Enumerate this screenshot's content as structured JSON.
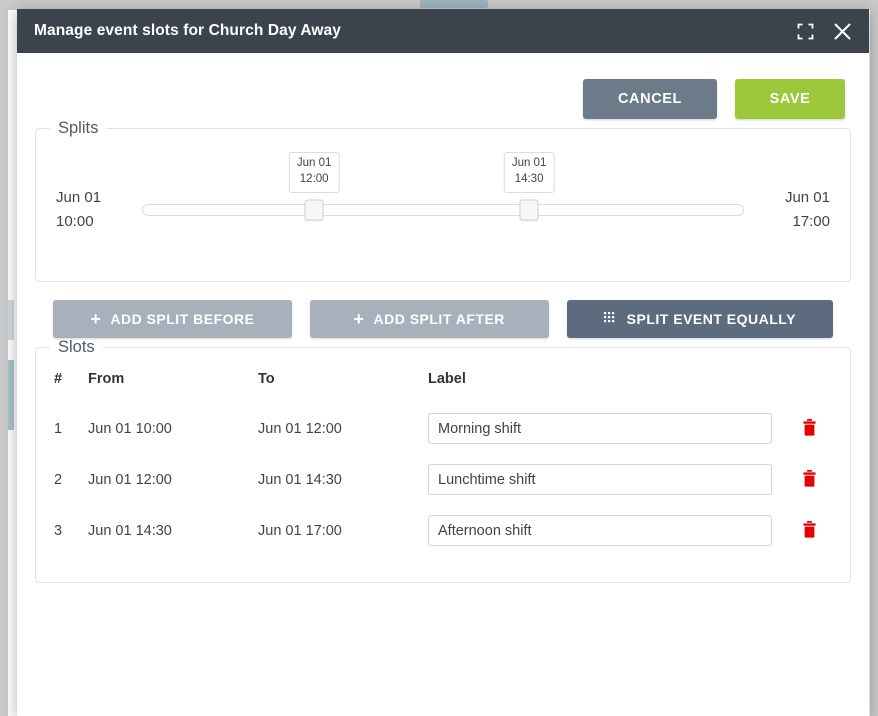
{
  "dialog": {
    "title": "Manage event slots for Church Day Away",
    "expand_icon": "expand-icon",
    "close_icon": "close-icon"
  },
  "top_actions": {
    "cancel_label": "CANCEL",
    "save_label": "SAVE",
    "cancel_color": "#6d7a89",
    "save_color": "#9cc93c"
  },
  "splits": {
    "legend": "Splits",
    "start_label": "Jun 01\n10:00",
    "start_date": "Jun 01",
    "start_time": "10:00",
    "end_date": "Jun 01",
    "end_time": "17:00",
    "handles": [
      {
        "date": "Jun 01",
        "time": "12:00",
        "position_pct": 28.6
      },
      {
        "date": "Jun 01",
        "time": "14:30",
        "position_pct": 64.3
      }
    ]
  },
  "split_actions": [
    {
      "label": "ADD SPLIT BEFORE",
      "icon": "plus-icon",
      "style": "light"
    },
    {
      "label": "ADD SPLIT AFTER",
      "icon": "plus-icon",
      "style": "light"
    },
    {
      "label": "SPLIT EVENT EQUALLY",
      "icon": "grid-icon",
      "style": "dark"
    }
  ],
  "slots": {
    "legend": "Slots",
    "columns": [
      "#",
      "From",
      "To",
      "Label"
    ],
    "rows": [
      {
        "num": "1",
        "from": "Jun 01 10:00",
        "to": "Jun 01 12:00",
        "label": "Morning shift"
      },
      {
        "num": "2",
        "from": "Jun 01 12:00",
        "to": "Jun 01 14:30",
        "label": "Lunchtime shift"
      },
      {
        "num": "3",
        "from": "Jun 01 14:30",
        "to": "Jun 01 17:00",
        "label": "Afternoon shift"
      }
    ],
    "delete_icon": "trash-icon",
    "delete_color": "#e60000"
  }
}
